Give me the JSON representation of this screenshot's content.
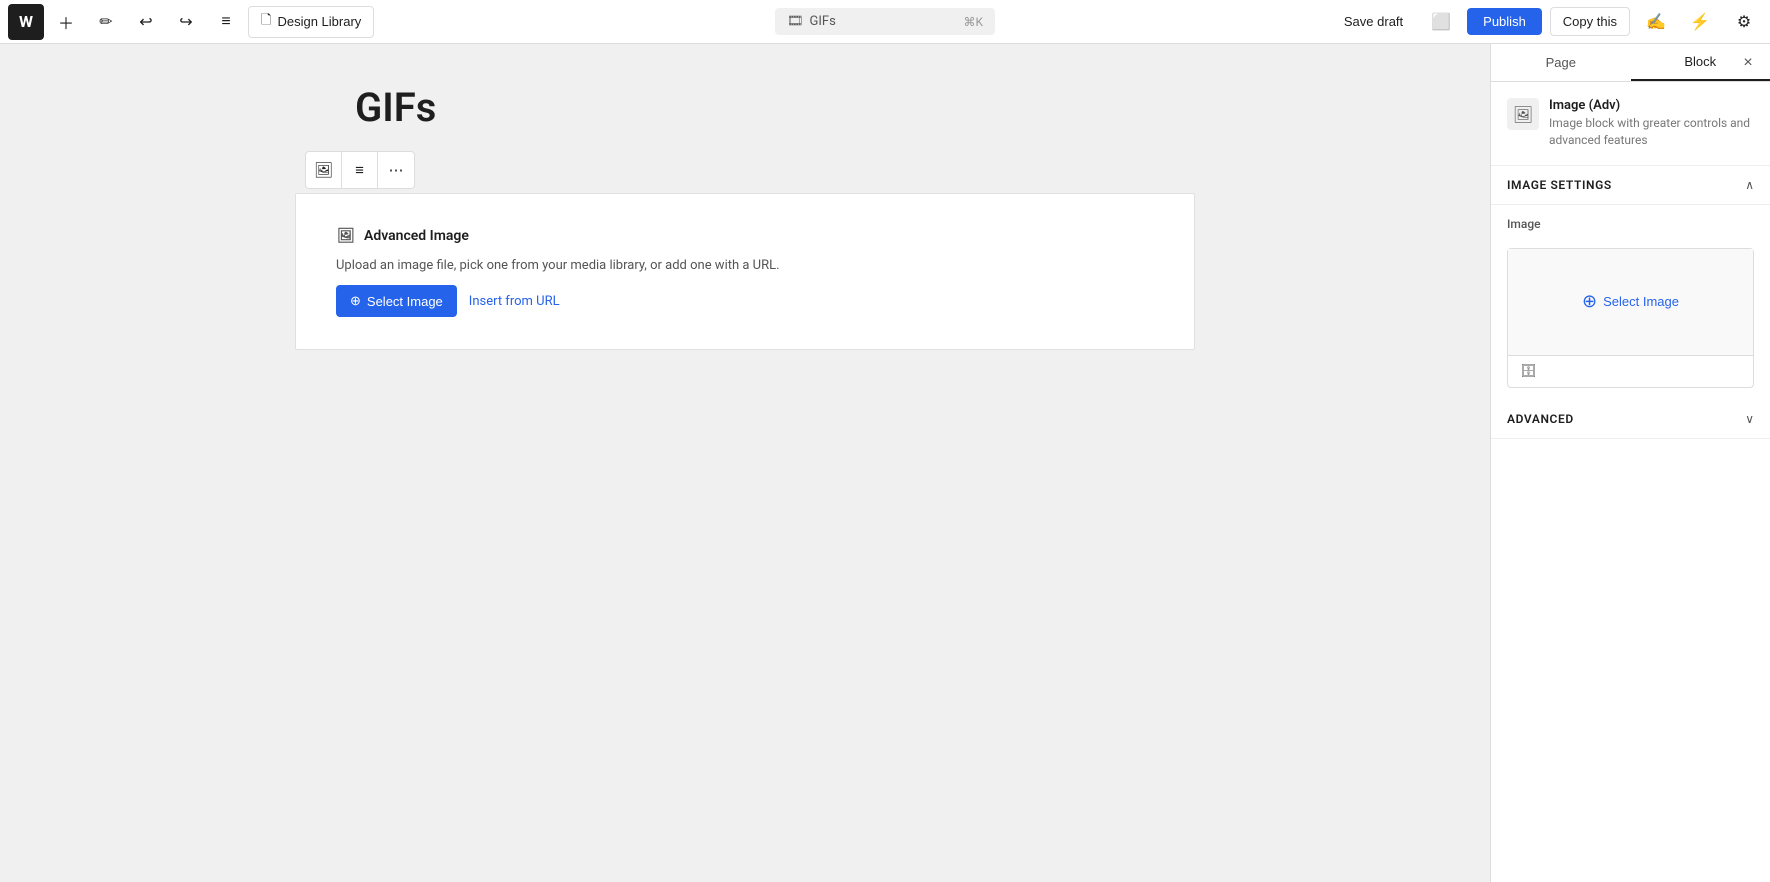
{
  "toolbar": {
    "wp_logo": "W",
    "doc_title": "Design Library",
    "doc_icon": "🗋",
    "search_text": "GIFs",
    "search_shortcut": "⌘K",
    "save_draft_label": "Save draft",
    "publish_label": "Publish",
    "copy_this_label": "Copy this"
  },
  "block_toolbar": {
    "image_icon": "🖼",
    "list_icon": "≡",
    "more_icon": "⋯"
  },
  "editor": {
    "page_title": "GIFs",
    "block": {
      "title": "Advanced Image",
      "description": "Upload an image file, pick one from your media library, or add one with a URL.",
      "select_image_label": "Select Image",
      "insert_url_label": "Insert from URL"
    }
  },
  "sidebar": {
    "tab_page": "Page",
    "tab_block": "Block",
    "close_label": "×",
    "block_info": {
      "title": "Image (Adv)",
      "description": "Image block with greater controls and advanced features"
    },
    "image_settings": {
      "section_title": "Image settings",
      "image_label": "Image",
      "select_image_label": "Select Image",
      "select_image_icon": "⊕",
      "footer_icon": "🗄"
    },
    "advanced": {
      "section_title": "Advanced"
    }
  }
}
